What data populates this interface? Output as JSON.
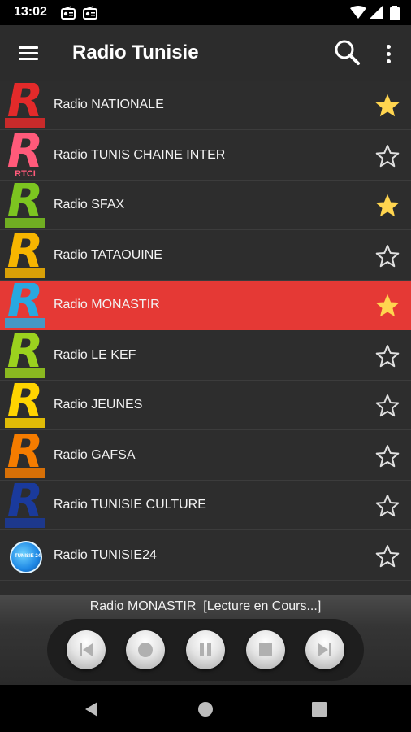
{
  "status_bar": {
    "time": "13:02",
    "icons": [
      "radio-icon",
      "radio-icon",
      "wifi-icon",
      "signal-icon",
      "battery-icon"
    ]
  },
  "app_bar": {
    "title": "Radio Tunisie",
    "icons": [
      "menu-icon",
      "search-icon",
      "more-vert-icon"
    ]
  },
  "stations": [
    {
      "name": "Radio NATIONALE",
      "logo_letter": "R",
      "logo_color": "#e32a2a",
      "logo_sub_color": "#e32a2a",
      "favorite": true,
      "active": false
    },
    {
      "name": "Radio TUNIS CHAINE INTER",
      "logo_letter": "R",
      "logo_color": "#ff5a7a",
      "logo_sub_color": "",
      "logo_sub_text": "RTCI",
      "favorite": false,
      "active": false
    },
    {
      "name": "Radio SFAX",
      "logo_letter": "R",
      "logo_color": "#7cc520",
      "logo_sub_color": "#7cc520",
      "favorite": true,
      "active": false
    },
    {
      "name": "Radio TATAOUINE",
      "logo_letter": "R",
      "logo_color": "#f7b500",
      "logo_sub_color": "#f7b500",
      "favorite": false,
      "active": false
    },
    {
      "name": "Radio MONASTIR",
      "logo_letter": "R",
      "logo_color": "#29a8e0",
      "logo_sub_color": "#29a8e0",
      "favorite": true,
      "active": true
    },
    {
      "name": "Radio LE KEF",
      "logo_letter": "R",
      "logo_color": "#9bd11e",
      "logo_sub_color": "#9bd11e",
      "favorite": false,
      "active": false
    },
    {
      "name": "Radio JEUNES",
      "logo_letter": "R",
      "logo_color": "#ffd400",
      "logo_sub_color": "#ffd400",
      "favorite": false,
      "active": false
    },
    {
      "name": "Radio GAFSA",
      "logo_letter": "R",
      "logo_color": "#f57c00",
      "logo_sub_color": "#f57c00",
      "favorite": false,
      "active": false
    },
    {
      "name": "Radio TUNISIE CULTURE",
      "logo_letter": "R",
      "logo_color": "#1a3a9c",
      "logo_sub_color": "#1a3a9c",
      "favorite": false,
      "active": false
    },
    {
      "name": "Radio TUNISIE24",
      "logo_letter": "",
      "logo_color": "#1e88e5",
      "logo_sub_color": "",
      "logo_badge": "TUNISIE 24",
      "favorite": false,
      "active": false
    }
  ],
  "player": {
    "now_playing": "Radio MONASTIR  [Lecture en Cours...]",
    "controls": [
      "skip-previous-icon",
      "record-icon",
      "pause-icon",
      "stop-icon",
      "skip-next-icon"
    ]
  },
  "nav_bar": {
    "icons": [
      "back-icon",
      "home-icon",
      "recents-icon"
    ]
  },
  "colors": {
    "accent_active_row": "#e53935",
    "star_filled": "#ffd54f",
    "background": "#2d2d2d"
  }
}
